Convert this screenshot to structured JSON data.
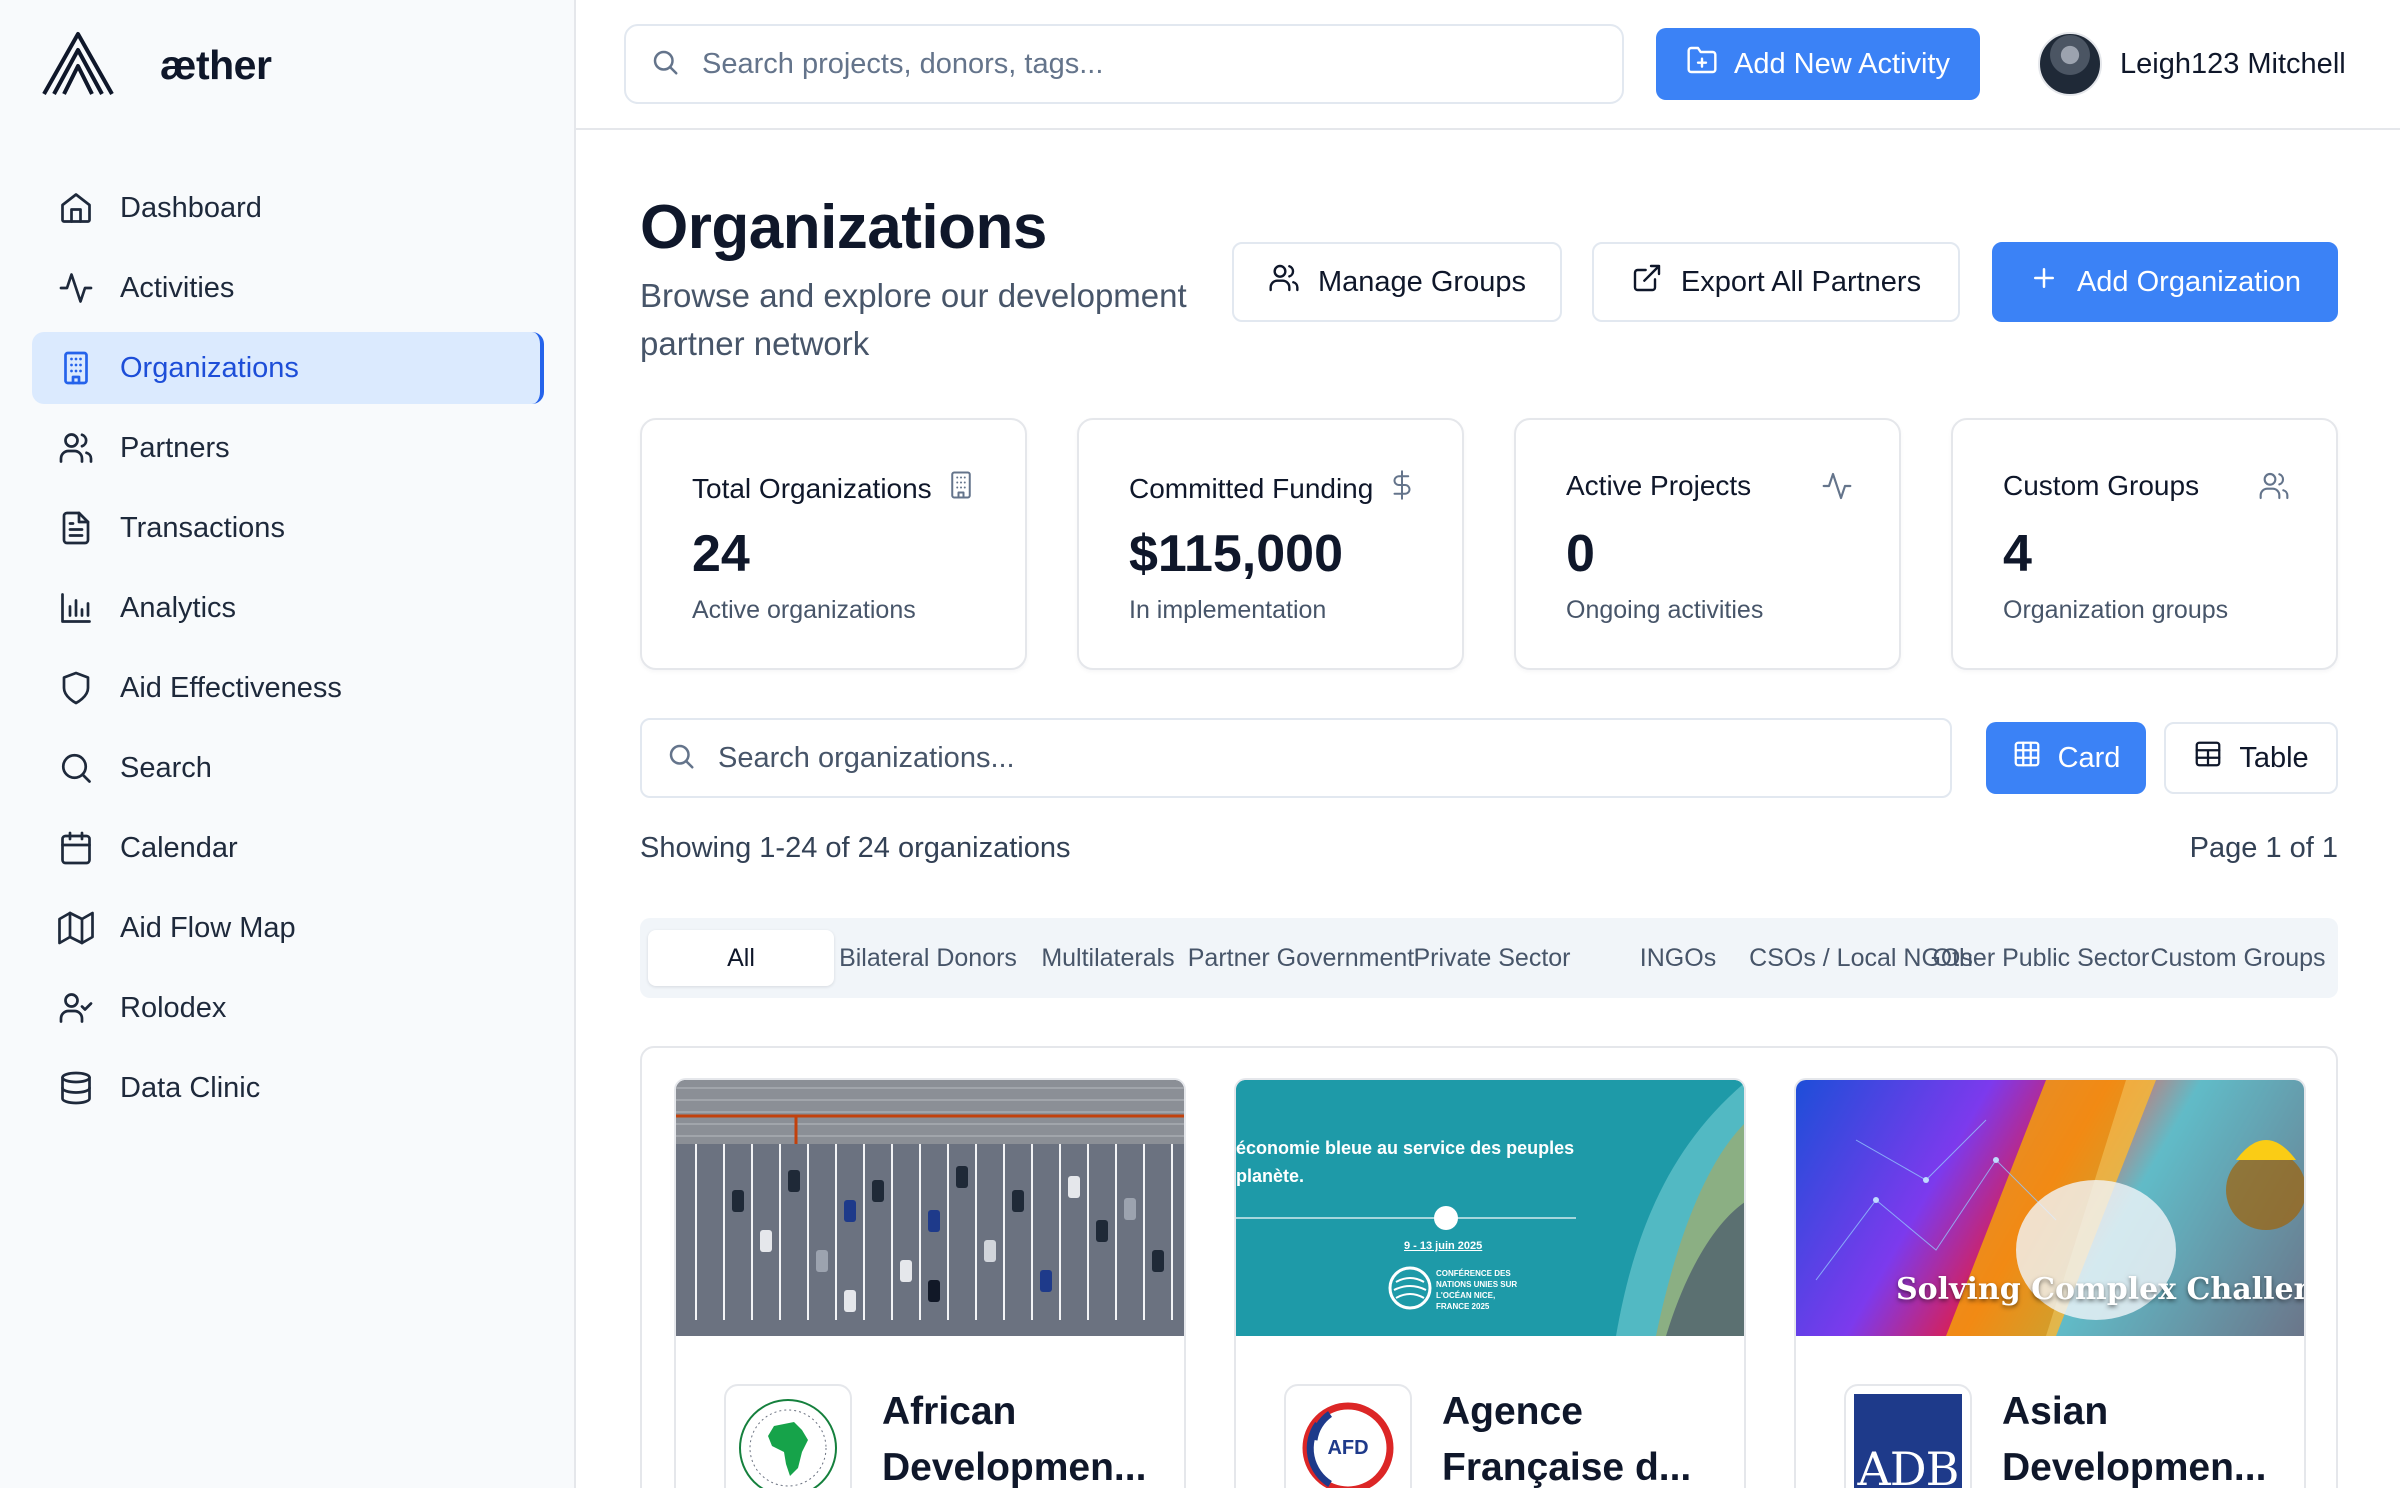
{
  "brand": {
    "name": "æther"
  },
  "sidebar": {
    "items": [
      {
        "label": "Dashboard",
        "icon": "home-icon"
      },
      {
        "label": "Activities",
        "icon": "activity-icon"
      },
      {
        "label": "Organizations",
        "icon": "building-icon",
        "active": true
      },
      {
        "label": "Partners",
        "icon": "users-icon"
      },
      {
        "label": "Transactions",
        "icon": "file-text-icon"
      },
      {
        "label": "Analytics",
        "icon": "bar-chart-icon"
      },
      {
        "label": "Aid Effectiveness",
        "icon": "shield-icon"
      },
      {
        "label": "Search",
        "icon": "search-icon"
      },
      {
        "label": "Calendar",
        "icon": "calendar-icon"
      },
      {
        "label": "Aid Flow Map",
        "icon": "map-icon"
      },
      {
        "label": "Rolodex",
        "icon": "user-check-icon"
      },
      {
        "label": "Data Clinic",
        "icon": "database-icon"
      }
    ]
  },
  "topbar": {
    "search_placeholder": "Search projects, donors, tags...",
    "add_activity_label": "Add New Activity",
    "user_name": "Leigh123 Mitchell"
  },
  "page": {
    "title": "Organizations",
    "subtitle": "Browse and explore our development partner network",
    "manage_groups_label": "Manage Groups",
    "export_label": "Export All Partners",
    "add_org_label": "Add Organization"
  },
  "stats": [
    {
      "label": "Total Organizations",
      "value": "24",
      "sub": "Active organizations",
      "icon": "building-icon"
    },
    {
      "label": "Committed Funding",
      "value": "$115,000",
      "sub": "In implementation",
      "icon": "dollar-icon"
    },
    {
      "label": "Active Projects",
      "value": "0",
      "sub": "Ongoing activities",
      "icon": "activity-icon"
    },
    {
      "label": "Custom Groups",
      "value": "4",
      "sub": "Organization groups",
      "icon": "users-icon"
    }
  ],
  "org_search": {
    "placeholder": "Search organizations..."
  },
  "view_toggle": {
    "card_label": "Card",
    "table_label": "Table",
    "selected": "Card"
  },
  "pagination": {
    "showing": "Showing 1-24 of 24 organizations",
    "page": "Page 1 of 1"
  },
  "tabs": [
    "All",
    "Bilateral Donors",
    "Multilaterals",
    "Partner Government",
    "Private Sector",
    "INGOs",
    "CSOs / Local NGOs",
    "Other Public Sector",
    "Custom Groups"
  ],
  "organizations": [
    {
      "name": "African Developmen...",
      "logo": "afdb-logo"
    },
    {
      "name": "Agence Française d...",
      "logo": "afd-logo",
      "logo_text": "AFD",
      "banner_text": "économie bleue au service des peuples planète.",
      "banner_date": "9 - 13 juin 2025",
      "banner_conf": "CONFÉRENCE DES NATIONS UNIES SUR L'OCÉAN NICE, FRANCE 2025"
    },
    {
      "name": "Asian Developmen...",
      "logo": "adb-logo",
      "logo_text": "ADB",
      "banner_text": "Solving Complex Challenges T"
    }
  ],
  "colors": {
    "accent": "#3b82f6",
    "active_nav_bg": "#dbeafe",
    "sidebar_bg": "#f8fafc"
  }
}
